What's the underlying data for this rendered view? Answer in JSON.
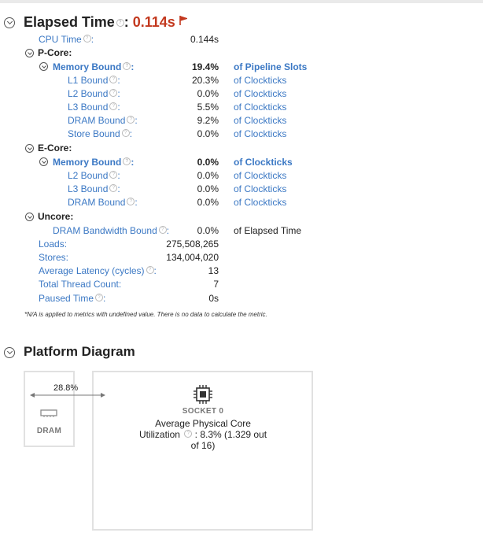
{
  "elapsed": {
    "title": "Elapsed Time",
    "colon": ":",
    "value": "0.114s"
  },
  "cpu_time": {
    "label": "CPU Time",
    "value": "0.144s"
  },
  "pcore": {
    "label": "P-Core:",
    "memory_bound": {
      "label": "Memory Bound",
      "value": "19.4%",
      "unit": "of Pipeline Slots"
    },
    "rows": [
      {
        "label": "L1 Bound",
        "value": "20.3%",
        "unit": "of Clockticks"
      },
      {
        "label": "L2 Bound",
        "value": "0.0%",
        "unit": "of Clockticks"
      },
      {
        "label": "L3 Bound",
        "value": "5.5%",
        "unit": "of Clockticks"
      },
      {
        "label": "DRAM Bound",
        "value": "9.2%",
        "unit": "of Clockticks"
      },
      {
        "label": "Store Bound",
        "value": "0.0%",
        "unit": "of Clockticks"
      }
    ]
  },
  "ecore": {
    "label": "E-Core:",
    "memory_bound": {
      "label": "Memory Bound",
      "value": "0.0%",
      "unit": "of Clockticks"
    },
    "rows": [
      {
        "label": "L2 Bound",
        "value": "0.0%",
        "unit": "of Clockticks"
      },
      {
        "label": "L3 Bound",
        "value": "0.0%",
        "unit": "of Clockticks"
      },
      {
        "label": "DRAM Bound",
        "value": "0.0%",
        "unit": "of Clockticks"
      }
    ]
  },
  "uncore": {
    "label": "Uncore:",
    "dram_bw": {
      "label": "DRAM Bandwidth Bound",
      "value": "0.0%",
      "unit": "of Elapsed Time"
    }
  },
  "stats": [
    {
      "label": "Loads:",
      "value": "275,508,265"
    },
    {
      "label": "Stores:",
      "value": "134,004,020"
    },
    {
      "label": "Average Latency (cycles)",
      "value": "13"
    },
    {
      "label": "Total Thread Count:",
      "value": "7"
    },
    {
      "label": "Paused Time",
      "value": "0s"
    }
  ],
  "note": "*N/A is applied to metrics with undefined value. There is no data to calculate the metric.",
  "platform": {
    "title": "Platform Diagram",
    "link_pct": "28.8%",
    "dram_label": "DRAM",
    "socket_label": "SOCKET 0",
    "util_line1": "Average Physical Core",
    "util_line2a": "Utilization",
    "util_line2b": ": 8.3% (1.329 out",
    "util_line3": "of 16)"
  },
  "colors": {
    "accent": "#3b78c4",
    "elapsed": "#c3391f"
  }
}
